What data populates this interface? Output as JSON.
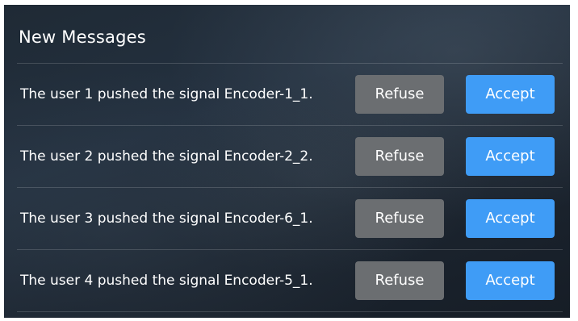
{
  "panel": {
    "title": "New Messages"
  },
  "messages": [
    {
      "text": "The user 1 pushed the signal Encoder-1_1.",
      "refuse_label": "Refuse",
      "accept_label": "Accept"
    },
    {
      "text": "The user 2 pushed the signal Encoder-2_2.",
      "refuse_label": "Refuse",
      "accept_label": "Accept"
    },
    {
      "text": "The user 3 pushed the signal Encoder-6_1.",
      "refuse_label": "Refuse",
      "accept_label": "Accept"
    },
    {
      "text": "The user 4 pushed the signal Encoder-5_1.",
      "refuse_label": "Refuse",
      "accept_label": "Accept"
    }
  ],
  "colors": {
    "accept": "#3f9cf6",
    "refuse": "#6b6e71"
  }
}
